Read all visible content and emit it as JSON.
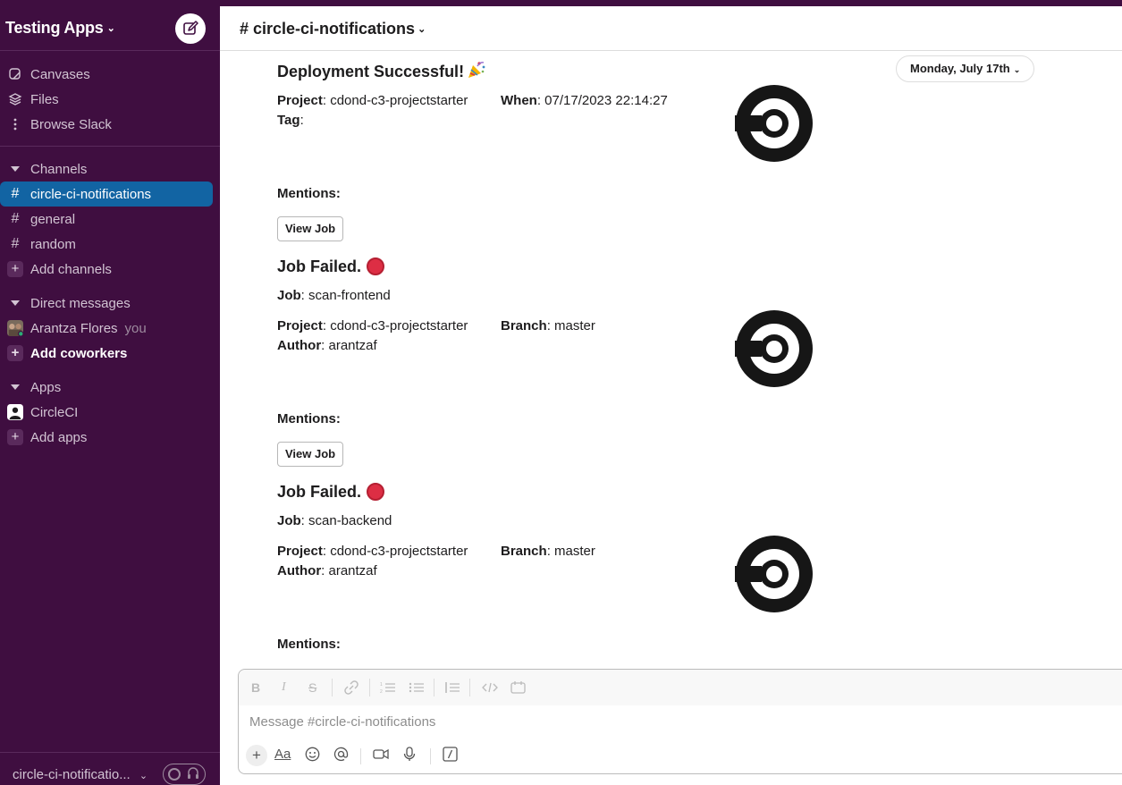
{
  "workspace": {
    "name": "Testing Apps",
    "chevron": "⌄",
    "compose_icon": "compose-icon"
  },
  "sidebar": {
    "top_items": [
      {
        "label": "Canvases",
        "icon": "canvas-icon"
      },
      {
        "label": "Files",
        "icon": "files-icon"
      },
      {
        "label": "Browse Slack",
        "icon": "more-icon"
      }
    ],
    "channels_header": "Channels",
    "channels": [
      {
        "label": "circle-ci-notifications",
        "active": true
      },
      {
        "label": "general",
        "active": false
      },
      {
        "label": "random",
        "active": false
      }
    ],
    "add_channels": "Add channels",
    "dm_header": "Direct messages",
    "dm_user": "Arantza Flores",
    "dm_you": "you",
    "add_coworkers": "Add coworkers",
    "apps_header": "Apps",
    "app": "CircleCI",
    "add_apps": "Add apps",
    "footer_status": "circle-ci-notificatio...",
    "footer_chevron": "⌄"
  },
  "channel": {
    "title": "# circle-ci-notifications",
    "chevron": "⌄",
    "date_pill": "Monday, July 17th"
  },
  "messages": [
    {
      "title": "Deployment Successful!",
      "project_label": "Project",
      "project": ": cdond-c3-projectstarter",
      "when_label": "When",
      "when": ": 07/17/2023 22:14:27",
      "tag_label": "Tag",
      "tag": ":",
      "mentions": "Mentions:",
      "button": "View Job"
    },
    {
      "title": "Job Failed.",
      "job_label": "Job",
      "job": ": scan-frontend",
      "project_label": "Project",
      "project": ": cdond-c3-projectstarter",
      "branch_label": "Branch",
      "branch": ": master",
      "author_label": "Author",
      "author": ": arantzaf",
      "mentions": "Mentions:",
      "button": "View Job"
    },
    {
      "title": "Job Failed.",
      "job_label": "Job",
      "job": ": scan-backend",
      "project_label": "Project",
      "project": ": cdond-c3-projectstarter",
      "branch_label": "Branch",
      "branch": ": master",
      "author_label": "Author",
      "author": ": arantzaf",
      "mentions": "Mentions:"
    }
  ],
  "composer": {
    "placeholder": "Message #circle-ci-notifications",
    "format_buttons": [
      "B",
      "I",
      "S",
      "link",
      "ordered-list",
      "bulleted-list",
      "block-quote",
      "code",
      "code-block"
    ],
    "text_format_label": "Aa"
  },
  "colors": {
    "sidebar_bg": "#3f0e40",
    "active_item": "#1264a3",
    "failure_red": "#dd2e44"
  }
}
